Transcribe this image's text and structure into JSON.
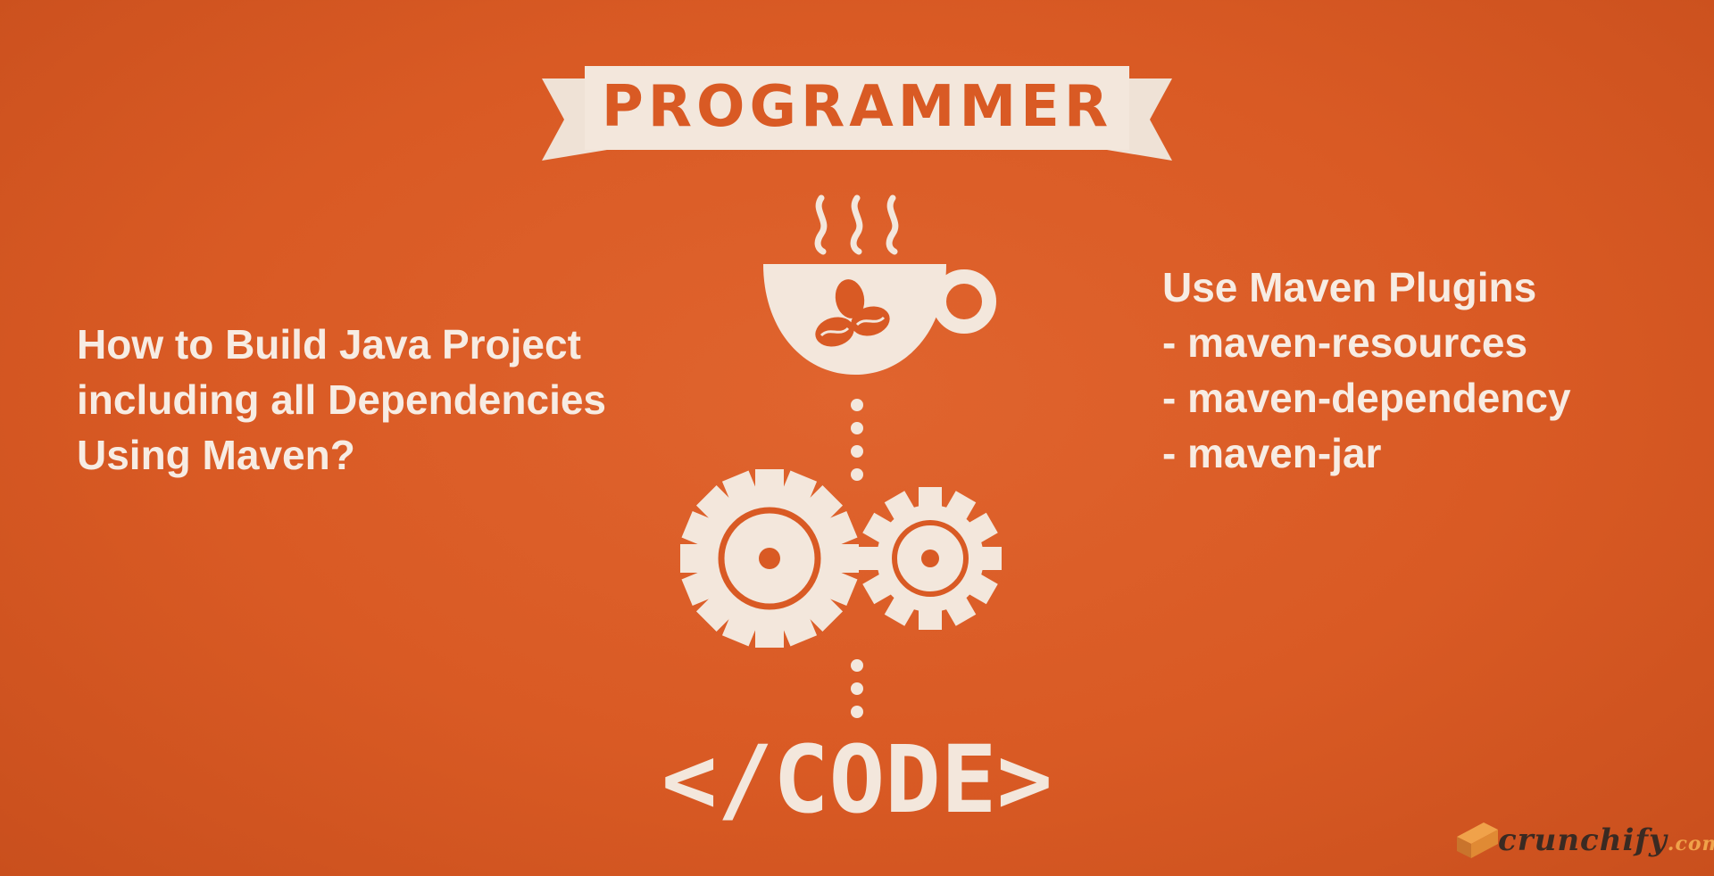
{
  "banner": {
    "title": "PROGRAMMER"
  },
  "illustration": {
    "cup_icon": "coffee-cup-icon",
    "bean_icon": "coffee-beans-icon",
    "gears_icon": "gears-icon",
    "code_label": "</CODE>"
  },
  "left_heading": {
    "lines": [
      "How to Build Java Project",
      "including all Dependencies",
      "Using Maven?"
    ]
  },
  "right_list": {
    "title": "Use Maven Plugins",
    "items": [
      "- maven-resources",
      "- maven-dependency",
      "- maven-jar"
    ]
  },
  "brand": {
    "name": "crunchify",
    "tld": ".com",
    "logo_icon": "crunchify-logo-icon"
  },
  "colors": {
    "background": "#d95a24",
    "foreground": "#f7ece3",
    "brand_dark": "#3a2a22",
    "brand_accent": "#f0a24a"
  }
}
